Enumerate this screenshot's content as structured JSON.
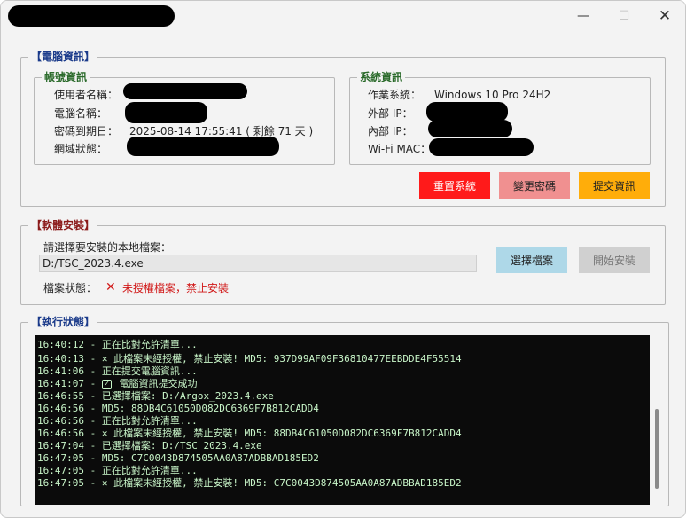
{
  "window": {
    "min_icon": "—",
    "max_icon": "☐",
    "close_icon": "✕"
  },
  "computer_info": {
    "title": "【電腦資訊】",
    "account": {
      "title": "帳號資訊",
      "username_label": "使用者名稱：",
      "computer_label": "電腦名稱：",
      "expiry_label": "密碼到期日：",
      "expiry_value": "2025-08-14 17:55:41 ( 剩餘 71 天 )",
      "domain_label": "網域狀態："
    },
    "system": {
      "title": "系統資訊",
      "os_label": "作業系統：",
      "os_value": "Windows 10 Pro 24H2",
      "external_ip_label": "外部 IP：",
      "internal_ip_label": "內部 IP：",
      "wifi_mac_label": "Wi-Fi MAC："
    },
    "buttons": {
      "reset": "重置系統",
      "change_password": "變更密碼",
      "submit": "提交資訊"
    }
  },
  "software": {
    "title": "【軟體安裝】",
    "prompt": "請選擇要安裝的本地檔案：",
    "file_path": "D:/TSC_2023.4.exe",
    "status_label": "檔案狀態：",
    "status_icon": "✕",
    "status_text": "未授權檔案，禁止安裝",
    "choose_button": "選擇檔案",
    "install_button": "開始安裝"
  },
  "execution": {
    "title": "【執行狀態】",
    "log": [
      {
        "text": "16:40:12 - 正在比對允許清單..."
      },
      {
        "text": "16:40:13 - ",
        "icon": "x",
        "rest": " 此檔案未經授權, 禁止安裝! MD5: 937D99AF09F36810477EEBDDE4F55514"
      },
      {
        "text": "16:41:06 - 正在提交電腦資訊..."
      },
      {
        "text": "16:41:07 - ",
        "icon": "check",
        "rest": " 電腦資訊提交成功"
      },
      {
        "text": "16:46:55 - 已選擇檔案: D:/Argox_2023.4.exe"
      },
      {
        "text": "16:46:56 - MD5: 88DB4C61050D082DC6369F7B812CADD4"
      },
      {
        "text": "16:46:56 - 正在比對允許清單..."
      },
      {
        "text": "16:46:56 - ",
        "icon": "x",
        "rest": " 此檔案未經授權, 禁止安裝! MD5: 88DB4C61050D082DC6369F7B812CADD4"
      },
      {
        "text": "16:47:04 - 已選擇檔案: D:/TSC_2023.4.exe"
      },
      {
        "text": "16:47:05 - MD5: C7C0043D874505AA0A87ADBBAD185ED2"
      },
      {
        "text": "16:47:05 - 正在比對允許清單..."
      },
      {
        "text": "16:47:05 - ",
        "icon": "x",
        "rest": " 此檔案未經授權, 禁止安裝! MD5: C7C0043D874505AA0A87ADBBAD185ED2"
      }
    ]
  },
  "colors": {
    "reset_button": "#ff1a1a",
    "password_button": "#f09090",
    "submit_button": "#ffad0a",
    "choose_button": "#aed8e8",
    "install_button": "#d0d0d0",
    "console_bg": "#0b0b0b",
    "console_text": "#c8f5c8",
    "error_red": "#d11a1a"
  }
}
